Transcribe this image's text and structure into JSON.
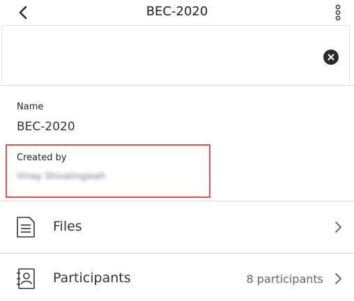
{
  "header": {
    "title": "BEC-2020",
    "back_icon": "chevron-left-icon",
    "more_icon": "more-vertical-icon"
  },
  "banner": {
    "clear_icon": "close-circle-icon"
  },
  "details": {
    "name_label": "Name",
    "name_value": "BEC-2020",
    "created_by_label": "Created by",
    "created_by_value": "Vinay Shivalingaiah"
  },
  "rows": [
    {
      "label": "Files",
      "meta": "",
      "icon": "document-icon"
    },
    {
      "label": "Participants",
      "meta": "8 participants",
      "icon": "contacts-book-icon"
    }
  ],
  "colors": {
    "highlight": "#d9534f",
    "divider": "#d8d8d8",
    "text": "#222222"
  }
}
